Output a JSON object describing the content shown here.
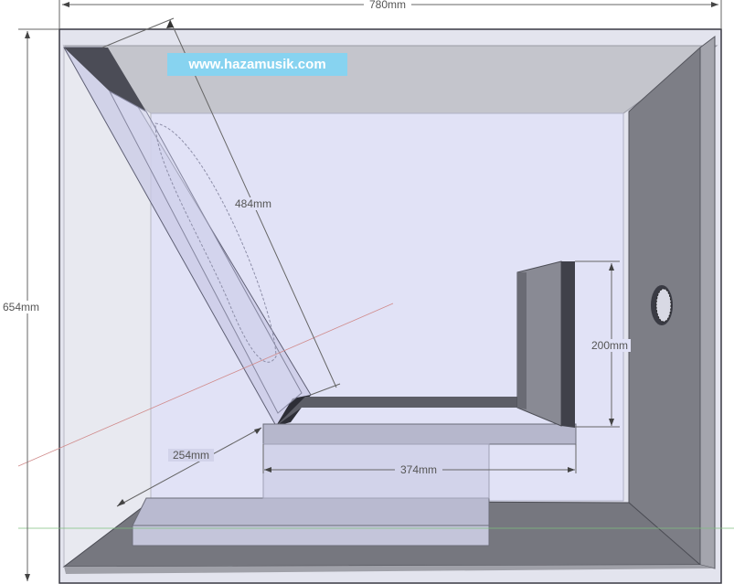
{
  "watermark": {
    "text": "www.hazamusik.com"
  },
  "dimensions": {
    "overall_width": "780mm",
    "overall_height": "654mm",
    "slanted_panel": "484mm",
    "vertical_panel": "200mm",
    "floor_segment": "374mm",
    "depth": "254mm"
  },
  "colors": {
    "outline": "#3a3a44",
    "side_wall_dark": "#7d7e86",
    "floor_dark": "#76777f",
    "top_panel": "#c4c5cc",
    "back_wall": "#e1e2f6",
    "panel_tint": "#c9cae6",
    "watermark_bg": "#87d3f0"
  },
  "icons": {
    "port": "port-tube-icon"
  }
}
